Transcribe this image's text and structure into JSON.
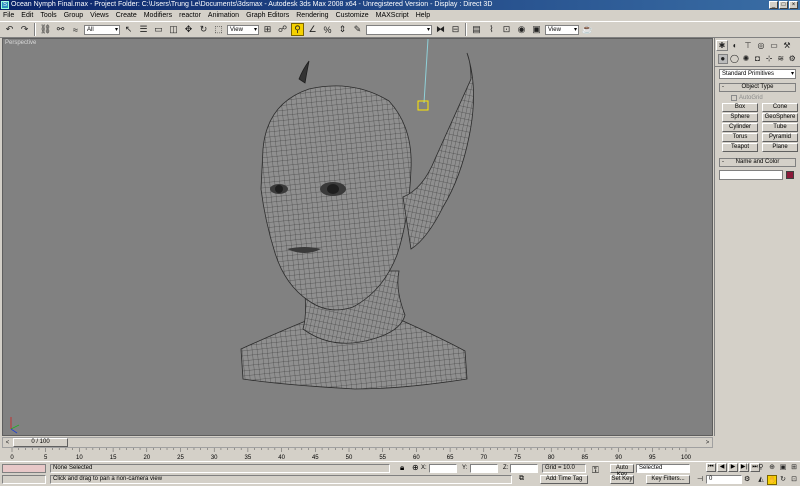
{
  "window": {
    "title": "Ocean Nymph Final.max   - Project Folder: C:\\Users\\Trung Le\\Documents\\3dsmax    - Autodesk 3ds Max 2008 x64    - Unregistered Version        - Display : Direct 3D",
    "app_icon": "3ds-max-icon",
    "minimize": "_",
    "maximize": "□",
    "close": "×"
  },
  "menu": [
    "File",
    "Edit",
    "Tools",
    "Group",
    "Views",
    "Create",
    "Modifiers",
    "reactor",
    "Animation",
    "Graph Editors",
    "Rendering",
    "Customize",
    "MAXScript",
    "Help"
  ],
  "toolbar": {
    "selection_filter": "All",
    "reference_coord": "View",
    "named_selection": "",
    "render_view": "View"
  },
  "viewport": {
    "label": "Perspective",
    "background": "#818181",
    "mesh_color": "#2b2b2b",
    "skin_color": "#8f8f8f"
  },
  "command_panel": {
    "category": "Standard Primitives",
    "object_type_title": "Object Type",
    "autogrid_label": "AutoGrid",
    "primitives": [
      "Box",
      "Cone",
      "Sphere",
      "GeoSphere",
      "Cylinder",
      "Tube",
      "Torus",
      "Pyramid",
      "Teapot",
      "Plane"
    ],
    "name_color_title": "Name and Color",
    "object_name": "",
    "object_color": "#8b1a3a"
  },
  "time_slider": {
    "position": "0 / 100",
    "prev": "<",
    "next": ">"
  },
  "track_ticks": [
    "0",
    "5",
    "10",
    "15",
    "20",
    "25",
    "30",
    "35",
    "40",
    "45",
    "50",
    "55",
    "60",
    "65",
    "70",
    "75",
    "80",
    "85",
    "90",
    "95",
    "100"
  ],
  "status": {
    "selection": "None Selected",
    "prompt": "Click and drag to pan a non-camera view",
    "x_label": "X:",
    "y_label": "Y:",
    "z_label": "Z:",
    "x_value": "",
    "y_value": "",
    "z_value": "",
    "grid": "Grid = 10.0",
    "add_time_tag": "Add Time Tag",
    "auto_key": "Auto Key",
    "set_key": "Set Key",
    "key_filters": "Key Filters...",
    "key_mode": "Selected",
    "frame": "0"
  }
}
